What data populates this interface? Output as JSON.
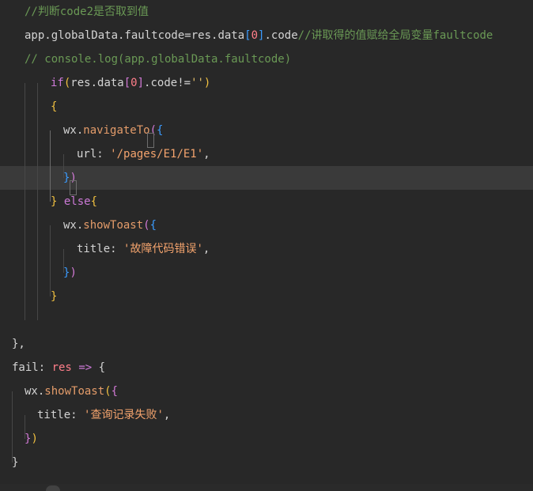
{
  "editor": {
    "lines": [
      {
        "tokens": [
          {
            "t": "//判断code2是否取到值",
            "c": "c-comment"
          }
        ]
      },
      {
        "tokens": [
          {
            "t": "app.globalData.faultcode",
            "c": "c-plain"
          },
          {
            "t": "=",
            "c": "c-plain"
          },
          {
            "t": "res.data",
            "c": "c-plain"
          },
          {
            "t": "[",
            "c": "b3"
          },
          {
            "t": "0",
            "c": "c-red"
          },
          {
            "t": "]",
            "c": "b3"
          },
          {
            "t": ".code",
            "c": "c-plain"
          },
          {
            "t": "//讲取得的值赋给全局变量faultcode",
            "c": "c-comment"
          }
        ]
      },
      {
        "tokens": [
          {
            "t": "// console.log(app.globalData.faultcode)",
            "c": "c-comment"
          }
        ]
      },
      {
        "tokens": [
          {
            "t": "if",
            "c": "c-kw"
          },
          {
            "t": "(",
            "c": "b1"
          },
          {
            "t": "res.data",
            "c": "c-plain"
          },
          {
            "t": "[",
            "c": "b2"
          },
          {
            "t": "0",
            "c": "c-red"
          },
          {
            "t": "]",
            "c": "b2"
          },
          {
            "t": ".code!=",
            "c": "c-plain"
          },
          {
            "t": "''",
            "c": "c-str"
          },
          {
            "t": ")",
            "c": "b1"
          }
        ]
      },
      {
        "tokens": [
          {
            "t": "{",
            "c": "b1"
          }
        ]
      },
      {
        "tokens": [
          {
            "t": "wx.",
            "c": "c-plain"
          },
          {
            "t": "navigateTo",
            "c": "c-fn"
          },
          {
            "t": "(",
            "c": "b2"
          },
          {
            "t": "{",
            "c": "b3"
          }
        ]
      },
      {
        "tokens": [
          {
            "t": "url",
            "c": "c-plain"
          },
          {
            "t": ": ",
            "c": "c-plain"
          },
          {
            "t": "'/pages/E1/E1'",
            "c": "c-str2"
          },
          {
            "t": ",",
            "c": "c-plain"
          }
        ]
      },
      {
        "tokens": [
          {
            "t": "}",
            "c": "b3"
          },
          {
            "t": ")",
            "c": "b2"
          }
        ]
      },
      {
        "tokens": [
          {
            "t": "}",
            "c": "b1"
          },
          {
            "t": " ",
            "c": "c-plain"
          },
          {
            "t": "else",
            "c": "c-kw"
          },
          {
            "t": "{",
            "c": "b1"
          }
        ]
      },
      {
        "tokens": [
          {
            "t": "wx.",
            "c": "c-plain"
          },
          {
            "t": "showToast",
            "c": "c-fn"
          },
          {
            "t": "(",
            "c": "b2"
          },
          {
            "t": "{",
            "c": "b3"
          }
        ]
      },
      {
        "tokens": [
          {
            "t": "title",
            "c": "c-plain"
          },
          {
            "t": ": ",
            "c": "c-plain"
          },
          {
            "t": "'故障代码错误'",
            "c": "c-str2"
          },
          {
            "t": ",",
            "c": "c-plain"
          }
        ]
      },
      {
        "tokens": [
          {
            "t": "}",
            "c": "b3"
          },
          {
            "t": ")",
            "c": "b2"
          }
        ]
      },
      {
        "tokens": [
          {
            "t": "}",
            "c": "b1"
          }
        ]
      },
      {
        "tokens": []
      },
      {
        "tokens": [
          {
            "t": "},",
            "c": "c-plain"
          }
        ]
      },
      {
        "tokens": [
          {
            "t": "fail",
            "c": "c-plain"
          },
          {
            "t": ": ",
            "c": "c-plain"
          },
          {
            "t": "res",
            "c": "c-red"
          },
          {
            "t": " ",
            "c": "c-plain"
          },
          {
            "t": "=>",
            "c": "c-kw"
          },
          {
            "t": " {",
            "c": "c-plain"
          }
        ]
      },
      {
        "tokens": [
          {
            "t": "wx.",
            "c": "c-plain"
          },
          {
            "t": "showToast",
            "c": "c-fn"
          },
          {
            "t": "(",
            "c": "b1"
          },
          {
            "t": "{",
            "c": "b2"
          }
        ]
      },
      {
        "tokens": [
          {
            "t": "title",
            "c": "c-plain"
          },
          {
            "t": ": ",
            "c": "c-plain"
          },
          {
            "t": "'查询记录失败'",
            "c": "c-str2"
          },
          {
            "t": ",",
            "c": "c-plain"
          }
        ]
      },
      {
        "tokens": [
          {
            "t": "}",
            "c": "b2"
          },
          {
            "t": ")",
            "c": "b1"
          }
        ]
      },
      {
        "tokens": [
          {
            "t": "}",
            "c": "c-plain"
          }
        ]
      }
    ],
    "active_line": 7
  }
}
